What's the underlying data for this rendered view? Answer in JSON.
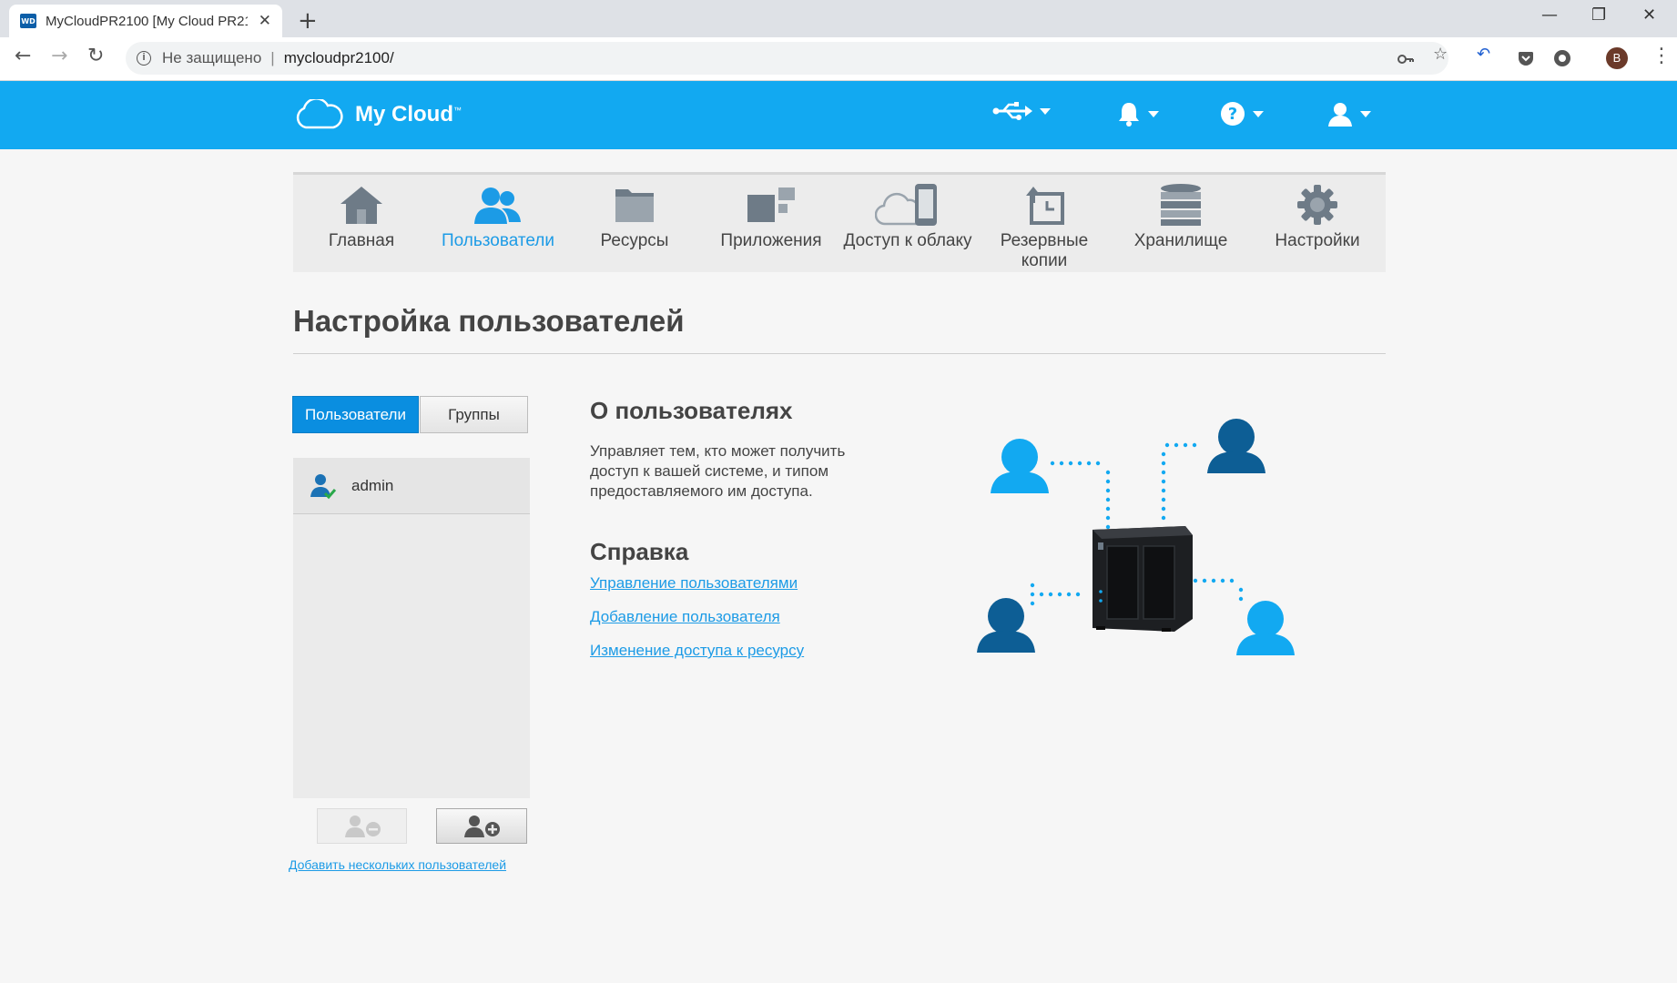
{
  "browser": {
    "tab_title": "MyCloudPR2100 [My Cloud PR2100]",
    "favicon_text": "WD",
    "insecure_label": "Не защищено",
    "url": "mycloudpr2100/",
    "profile_initial": "B",
    "icons": [
      "back-icon",
      "forward-icon",
      "reload-icon",
      "info-icon",
      "key-icon",
      "star-icon",
      "undo-icon",
      "pocket-icon",
      "extension-icon",
      "menu-icon"
    ]
  },
  "header": {
    "logo_text": "My Cloud",
    "logo_tm": "™",
    "icons": [
      "usb-icon",
      "bell-icon",
      "help-icon",
      "user-icon"
    ],
    "color": "#12a9f1"
  },
  "nav": {
    "items": [
      {
        "label": "Главная",
        "icon": "home-icon"
      },
      {
        "label": "Пользователи",
        "icon": "users-icon",
        "active": true
      },
      {
        "label": "Ресурсы",
        "icon": "folder-icon"
      },
      {
        "label": "Приложения",
        "icon": "apps-icon"
      },
      {
        "label": "Доступ к облаку",
        "icon": "cloud-device-icon"
      },
      {
        "label": "Резервные копии",
        "icon": "backup-icon"
      },
      {
        "label": "Хранилище",
        "icon": "storage-icon"
      },
      {
        "label": "Настройки",
        "icon": "gear-icon"
      }
    ],
    "active_color": "#1c9be6"
  },
  "page": {
    "title": "Настройка пользователей",
    "tabs": {
      "users": "Пользователи",
      "groups": "Группы"
    },
    "users": [
      {
        "name": "admin"
      }
    ],
    "add_multiple_link": "Добавить нескольких пользователей",
    "about": {
      "title": "О пользователях",
      "text": "Управляет тем, кто может получить доступ к вашей системе, и типом предоставляемого им доступа."
    },
    "help": {
      "title": "Справка",
      "links": [
        "Управление пользователями",
        "Добавление пользователя",
        "Изменение доступа к ресурсу"
      ]
    }
  }
}
